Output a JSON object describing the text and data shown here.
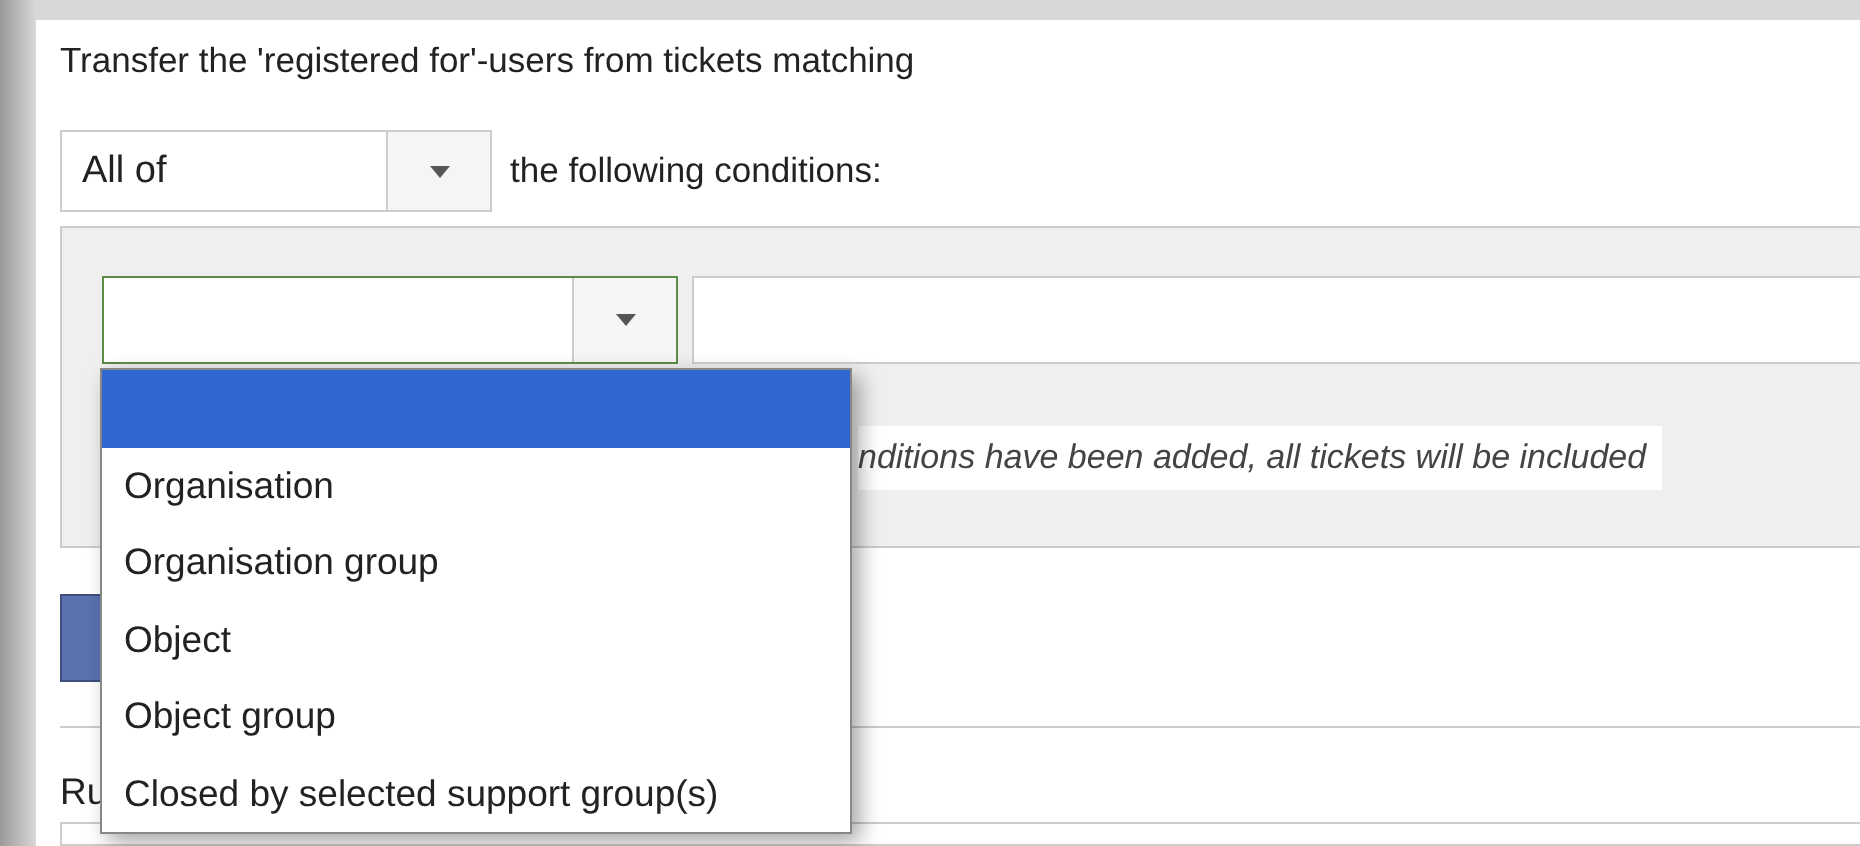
{
  "heading": "Transfer the 'registered for'-users from tickets matching",
  "match_select": {
    "value": "All of"
  },
  "match_suffix": "the following conditions:",
  "dropdown": {
    "options": [
      {
        "selected": true
      },
      {
        "label": "Organisation",
        "selected": false
      },
      {
        "label": "Organisation group",
        "selected": false
      },
      {
        "label": "Object",
        "selected": false
      },
      {
        "label": "Object group",
        "selected": false
      },
      {
        "label": "Closed by selected support group(s)",
        "selected": false
      }
    ]
  },
  "empty_note": "nditions have been added, all tickets will be included",
  "field_label": "Ru"
}
